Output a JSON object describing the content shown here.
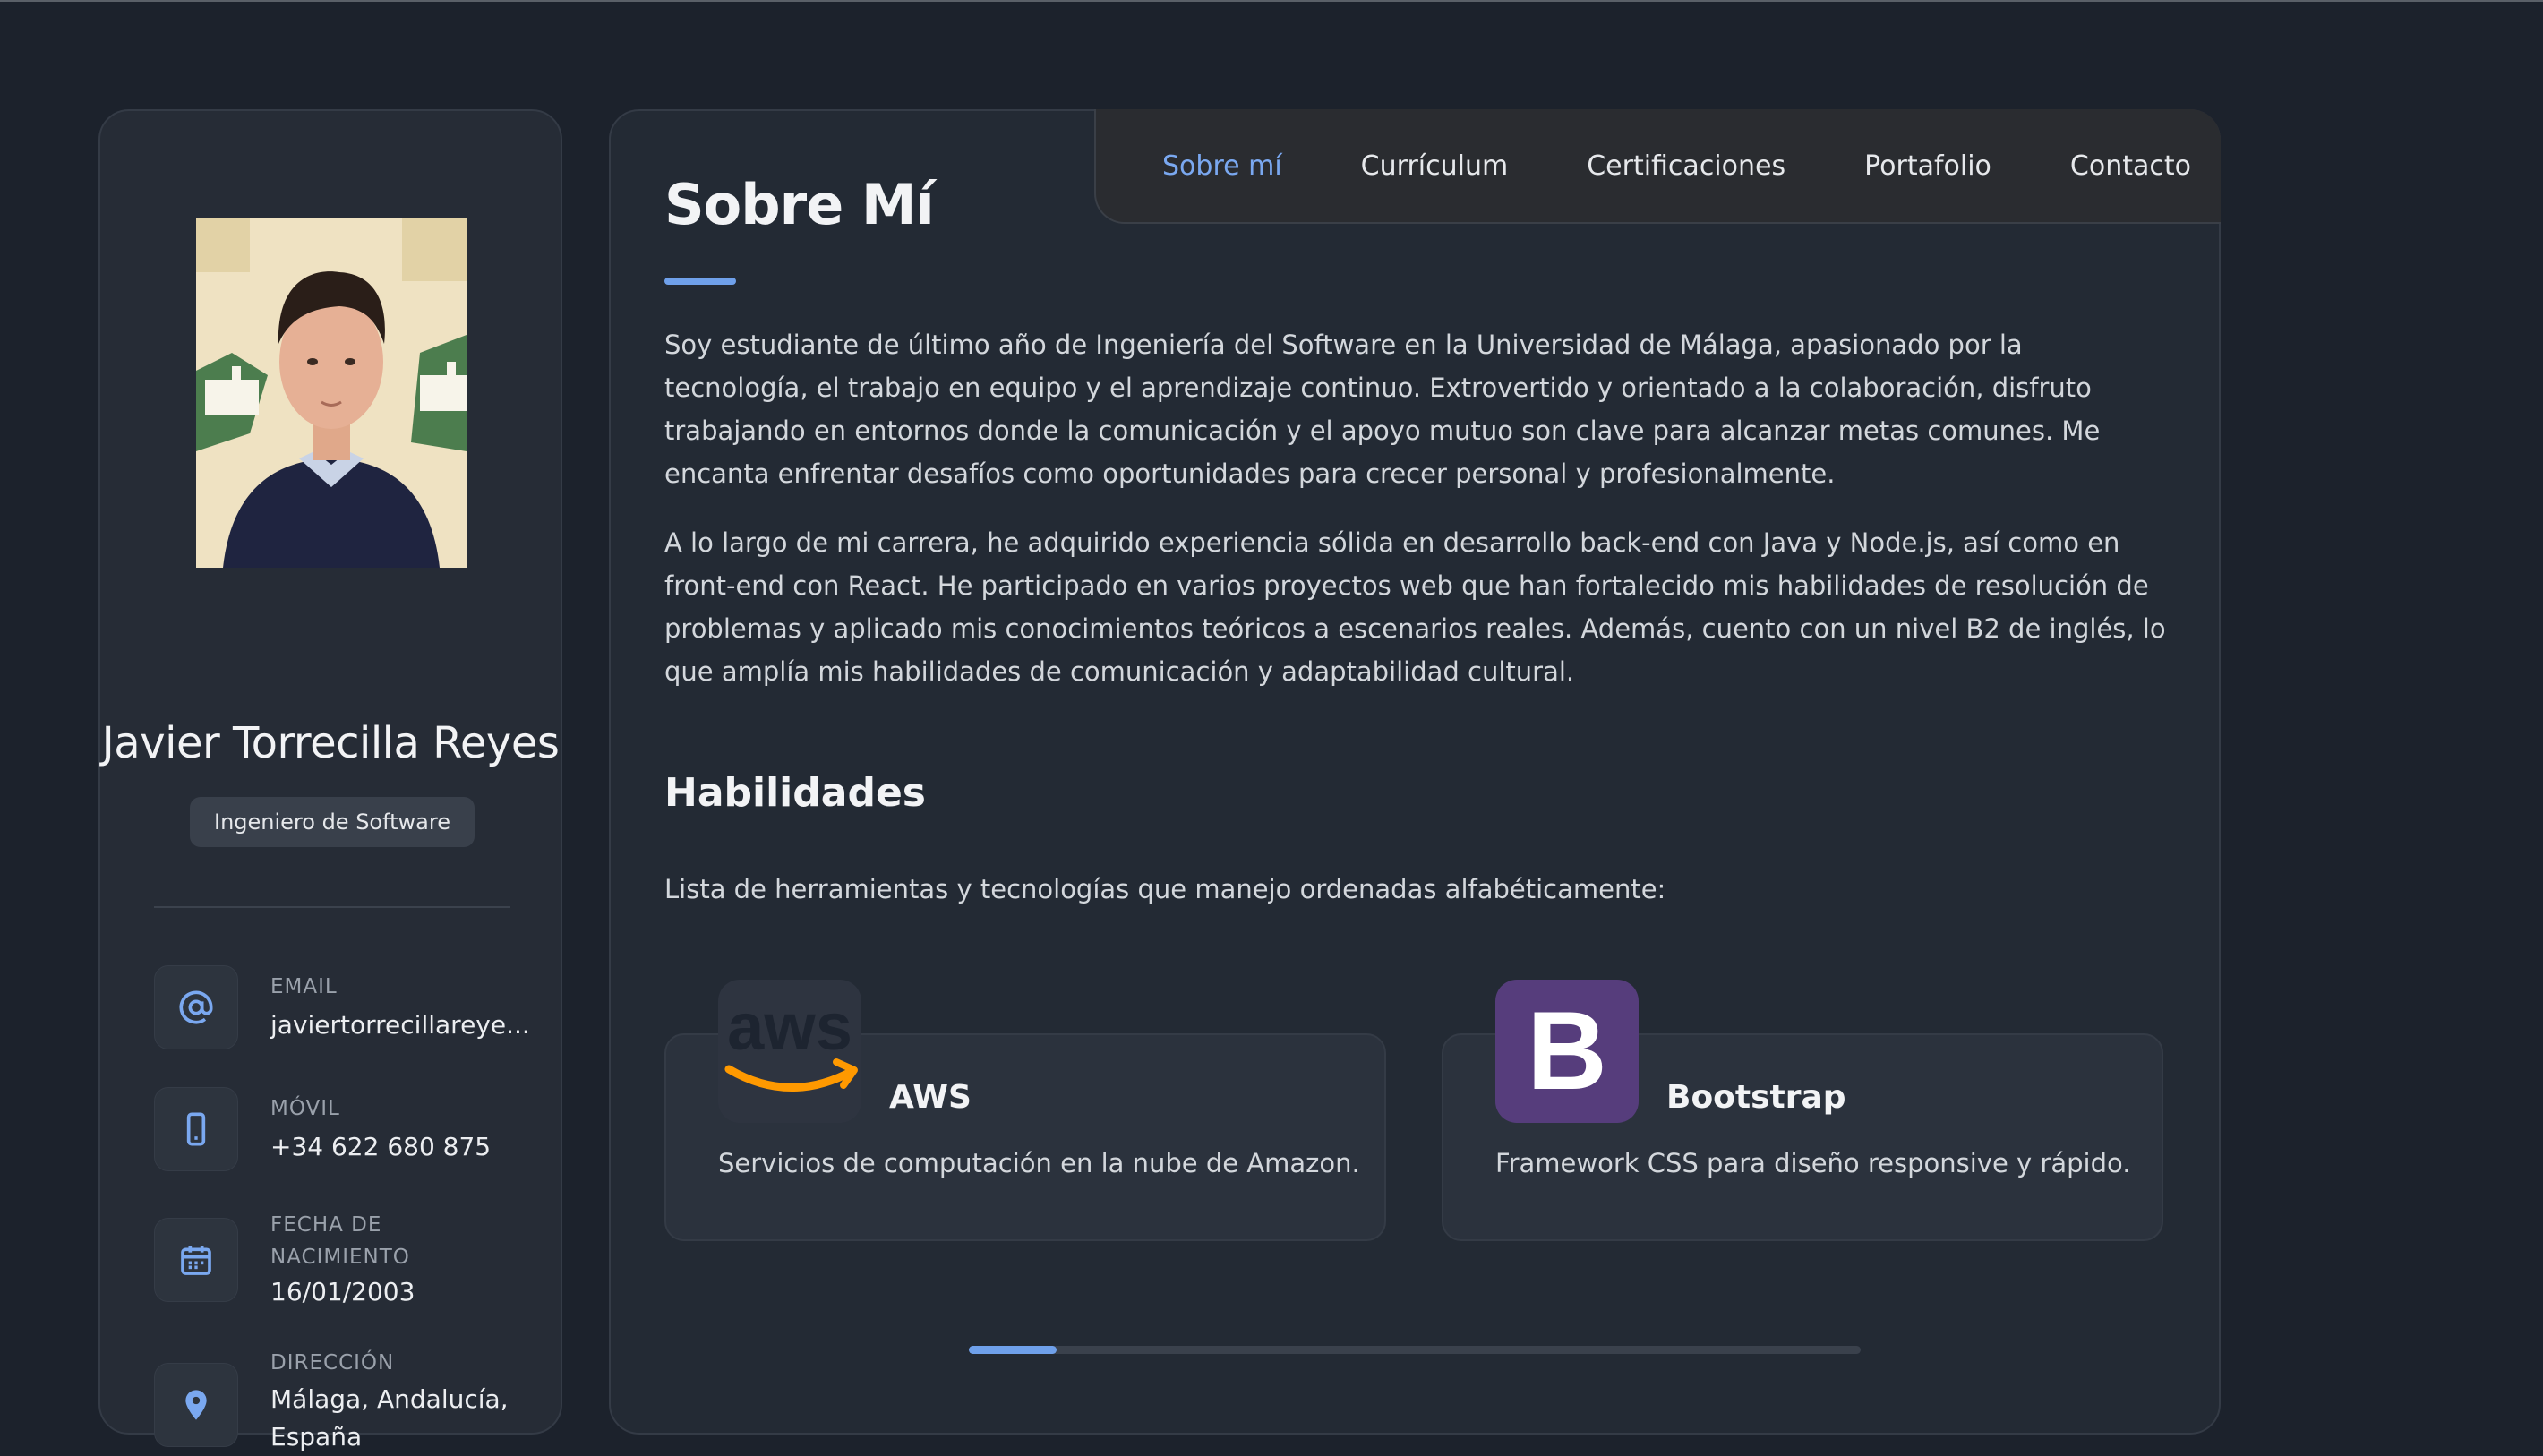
{
  "profile": {
    "name": "Javier Torrecilla Reyes",
    "role": "Ingeniero de Software",
    "info": [
      {
        "icon": "at-icon",
        "label": "EMAIL",
        "value": "javiertorrecillareye..."
      },
      {
        "icon": "phone-icon",
        "label": "MÓVIL",
        "value": "+34 622 680 875"
      },
      {
        "icon": "calendar-icon",
        "label_line1": "FECHA DE",
        "label_line2": "NACIMIENTO",
        "value": "16/01/2003"
      },
      {
        "icon": "map-pin-icon",
        "label": "DIRECCIÓN",
        "value_line1": "Málaga, Andalucía,",
        "value_line2": "España"
      }
    ]
  },
  "nav": {
    "items": [
      "Sobre mí",
      "Currículum",
      "Certificaciones",
      "Portafolio",
      "Contacto"
    ],
    "active_index": 0
  },
  "main": {
    "title": "Sobre Mí",
    "paragraphs": [
      "Soy estudiante de último año de Ingeniería del Software en la Universidad de Málaga, apasionado por la tecnología, el trabajo en equipo y el aprendizaje continuo. Extrovertido y orientado a la colaboración, disfruto trabajando en entornos donde la comunicación y el apoyo mutuo son clave para alcanzar metas comunes. Me encanta enfrentar desafíos como oportunidades para crecer personal y profesionalmente.",
      "A lo largo de mi carrera, he adquirido experiencia sólida en desarrollo back-end con Java y Node.js, así como en front-end con React. He participado en varios proyectos web que han fortalecido mis habilidades de resolución de problemas y aplicado mis conocimientos teóricos a escenarios reales. Además, cuento con un nivel B2 de inglés, lo que amplía mis habilidades de comunicación y adaptabilidad cultural."
    ],
    "skills_title": "Habilidades",
    "skills_intro": "Lista de herramientas y tecnologías que manejo ordenadas alfabéticamente:",
    "skills": [
      {
        "name": "AWS",
        "description": "Servicios de computación en la nube de Amazon.",
        "logo_text": "aws",
        "logo_icon": "aws-logo-icon"
      },
      {
        "name": "Bootstrap",
        "description": "Framework CSS para diseño responsive y rápido.",
        "logo_text": "B",
        "logo_icon": "bootstrap-logo-icon"
      }
    ]
  },
  "colors": {
    "background": "#1c222c",
    "card": "#232a34",
    "accent": "#7aa8f0",
    "bootstrap": "#563d7c",
    "aws_orange": "#ff9900"
  },
  "carousel": {
    "position_fraction": 0.1
  }
}
